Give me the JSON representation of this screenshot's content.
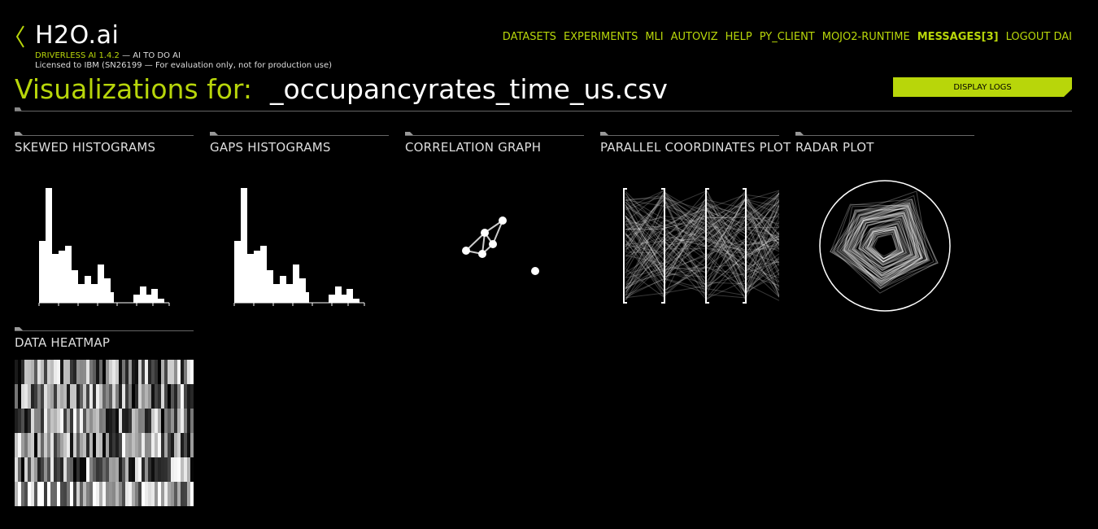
{
  "brand": {
    "name": "H2O.ai",
    "product": "DRIVERLESS AI 1.4.2",
    "tagline": " — AI TO DO AI",
    "license": "Licensed to IBM (SN26199 — For evaluation only, not for production use)"
  },
  "nav": {
    "items": [
      "DATASETS",
      "EXPERIMENTS",
      "MLI",
      "AUTOVIZ",
      "HELP",
      "PY_CLIENT",
      "MOJO2-RUNTIME",
      "MESSAGES[3]",
      "LOGOUT DAI"
    ]
  },
  "page": {
    "title_label": "Visualizations for:",
    "dataset": "_occupancyrates_time_us.csv",
    "display_logs": "DISPLAY LOGS"
  },
  "cards": [
    {
      "title": "SKEWED HISTOGRAMS"
    },
    {
      "title": "GAPS HISTOGRAMS"
    },
    {
      "title": "CORRELATION GRAPH"
    },
    {
      "title": "PARALLEL COORDINATES PLOT"
    },
    {
      "title": "RADAR PLOT"
    },
    {
      "title": "DATA HEATMAP"
    }
  ],
  "colors": {
    "accent": "#b8d60a",
    "background": "#000000"
  }
}
